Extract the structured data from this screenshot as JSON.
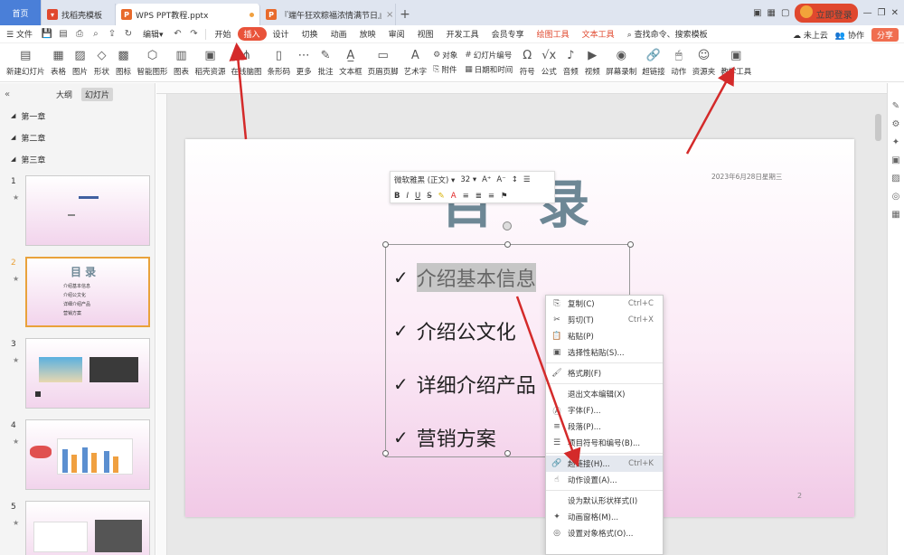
{
  "tabs": {
    "home": "首页",
    "t1": "找稻壳模板",
    "t2": "WPS PPT教程.pptx",
    "t3": "『端午狂欢粽福浓情满节日』"
  },
  "window": {
    "login": "立即登录"
  },
  "menu": {
    "file": "文件",
    "edit": "编辑",
    "items": [
      "开始",
      "插入",
      "设计",
      "切换",
      "动画",
      "放映",
      "审阅",
      "视图",
      "开发工具",
      "会员专享"
    ],
    "colored": [
      "绘图工具",
      "文本工具"
    ],
    "search": "查找命令、搜索模板",
    "cloud": "未上云",
    "collab": "协作",
    "share": "分享"
  },
  "ribbon": {
    "new_slide": "新建幻灯片",
    "table": "表格",
    "picture": "图片",
    "shape": "形状",
    "icon": "图标",
    "smartart": "智能图形",
    "chart": "图表",
    "stock": "稻壳资源",
    "flowchart": "在线脑图",
    "barcode": "条形码",
    "more": "更多",
    "comment": "批注",
    "textbox": "文本框",
    "headerfooter": "页眉页脚",
    "wordart": "艺术字",
    "object": "对象",
    "attach": "附件",
    "slidenum": "幻灯片编号",
    "datetime": "日期和时间",
    "symbol": "符号",
    "formula": "公式",
    "audio": "音频",
    "video": "视频",
    "record": "屏幕录制",
    "hyperlink": "超链接",
    "action": "动作",
    "resource": "资源夹",
    "teach": "教学工具"
  },
  "leftpanel": {
    "outline": "大纲",
    "slides": "幻灯片",
    "sections": [
      "第一章",
      "第二章",
      "第三章"
    ],
    "nums": [
      "1",
      "2",
      "3",
      "4",
      "5"
    ],
    "thumb2": {
      "title": "目 录",
      "items": [
        "介绍基本信息",
        "介绍公文化",
        "详细介绍产品",
        "营销方案"
      ]
    }
  },
  "slide": {
    "title": "目 录",
    "date": "2023年6月28日星期三",
    "bullets": [
      "介绍基本信息",
      "介绍公文化",
      "详细介绍产品",
      "营销方案"
    ],
    "check": "✓",
    "page": "2"
  },
  "minitb": {
    "font": "微软雅黑 (正文)",
    "size": "32"
  },
  "context": [
    {
      "icon": "copy-icon",
      "g": "⎘",
      "t": "复制(C)",
      "s": "Ctrl+C"
    },
    {
      "icon": "cut-icon",
      "g": "✂",
      "t": "剪切(T)",
      "s": "Ctrl+X"
    },
    {
      "icon": "paste-icon",
      "g": "📋",
      "t": "粘贴(P)",
      "s": ""
    },
    {
      "icon": "paste-special-icon",
      "g": "▣",
      "t": "选择性粘贴(S)...",
      "s": ""
    },
    {
      "sep": true
    },
    {
      "icon": "format-painter-icon",
      "g": "🖌",
      "t": "格式刷(F)",
      "s": ""
    },
    {
      "sep": true
    },
    {
      "icon": "",
      "g": "",
      "t": "退出文本编辑(X)",
      "s": ""
    },
    {
      "icon": "font-icon",
      "g": "Ⓐ",
      "t": "字体(F)...",
      "s": ""
    },
    {
      "icon": "paragraph-icon",
      "g": "≡",
      "t": "段落(P)...",
      "s": ""
    },
    {
      "icon": "bullets-icon",
      "g": "☰",
      "t": "项目符号和编号(B)...",
      "s": ""
    },
    {
      "sep": true
    },
    {
      "icon": "hyperlink-icon",
      "g": "🔗",
      "t": "超链接(H)...",
      "s": "Ctrl+K",
      "hov": true
    },
    {
      "icon": "action-icon",
      "g": "☝",
      "t": "动作设置(A)...",
      "s": ""
    },
    {
      "sep": true
    },
    {
      "icon": "",
      "g": "",
      "t": "设为默认形状样式(I)",
      "s": ""
    },
    {
      "icon": "animation-icon",
      "g": "✦",
      "t": "动画窗格(M)...",
      "s": ""
    },
    {
      "icon": "format-object-icon",
      "g": "◎",
      "t": "设置对象格式(O)...",
      "s": ""
    }
  ]
}
